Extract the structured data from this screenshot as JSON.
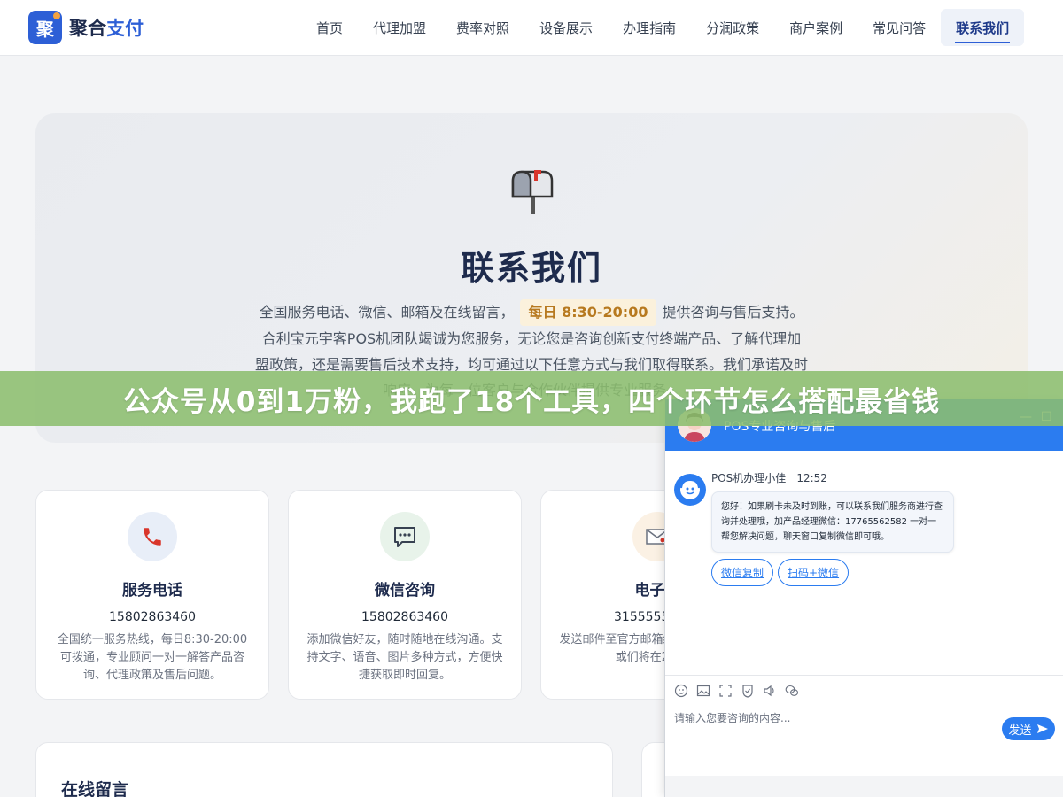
{
  "header": {
    "logo_badge": "聚",
    "logo_text_main": "聚合",
    "logo_text_accent": "支付",
    "nav": [
      {
        "label": "首页",
        "active": false
      },
      {
        "label": "代理加盟",
        "active": false
      },
      {
        "label": "费率对照",
        "active": false
      },
      {
        "label": "设备展示",
        "active": false
      },
      {
        "label": "办理指南",
        "active": false
      },
      {
        "label": "分润政策",
        "active": false
      },
      {
        "label": "商户案例",
        "active": false
      },
      {
        "label": "常见问答",
        "active": false
      },
      {
        "label": "联系我们",
        "active": true
      }
    ]
  },
  "hero": {
    "icon": "mailbox-icon",
    "title": "联系我们",
    "desc_part1": "全国服务电话、微信、邮箱及在线留言，",
    "hours": "每日 8:30-20:00",
    "desc_part2": "提供咨询与售后支持。合利宝元宇客POS机团队竭诚为您服务，无论您是咨询创新支付终端产品、了解代理加盟政策，还是需要售后技术支持，均可通过以下任意方式与我们取得联系。我们承诺及时响应，为每一位客户与合作伙伴提供专业服务。"
  },
  "cards": [
    {
      "icon": "phone-icon",
      "title": "服务电话",
      "value": "15802863460",
      "desc": "全国统一服务热线，每日8:30-20:00可拨通，专业顾问一对一解答产品咨询、代理政策及售后问题。"
    },
    {
      "icon": "wechat-icon",
      "title": "微信咨询",
      "value": "15802863460",
      "desc": "添加微信好友，随时随地在线沟通。支持文字、语音、图片多种方式，方便快捷获取即时回复。"
    },
    {
      "icon": "email-icon",
      "title": "电子邮",
      "value": "31555555535",
      "desc": "发送邮件至官方邮箱细资料、申请文件或们将在24小时"
    }
  ],
  "form": {
    "title": "在线留言"
  },
  "banner": {
    "text": "公众号从0到1万粉，我跑了18个工具，四个环节怎么搭配最省钱"
  },
  "chat": {
    "title": "POS专业咨询与售后",
    "minimize": "—",
    "maximize": "☐",
    "agent_name": "POS机办理小佳",
    "time": "12:52",
    "message": "您好！如果刷卡未及时到账，可以联系我们服务商进行查询并处理哦，加产品经理微信：17765562582 一对一帮您解决问题，聊天窗口复制微信即可哦。",
    "quick_buttons": [
      "微信复制",
      "扫码+微信"
    ],
    "input_placeholder": "请输入您要咨询的内容...",
    "send_label": "发送",
    "accent_color": "#2b7cf0"
  }
}
